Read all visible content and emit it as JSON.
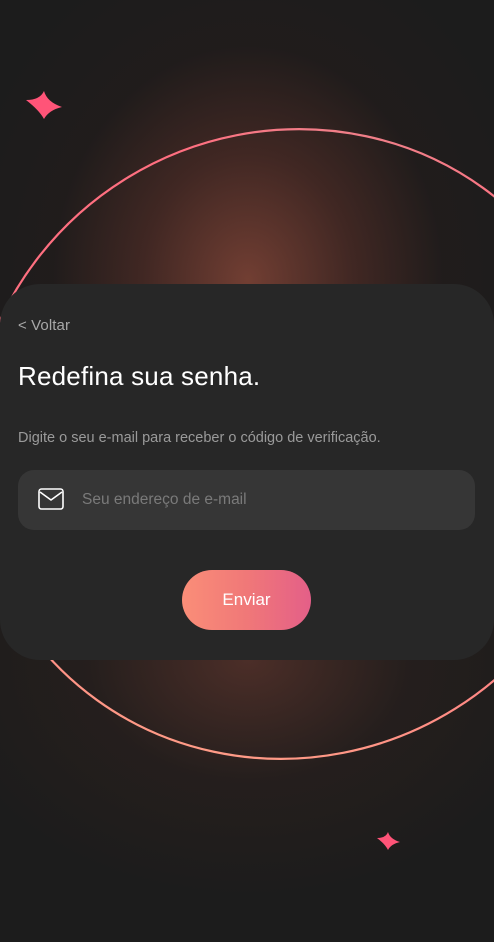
{
  "back_label": "< Voltar",
  "title": "Redefina sua senha.",
  "description": "Digite o seu e-mail para receber o código de verificação.",
  "email": {
    "placeholder": "Seu endereço de e-mail",
    "value": "",
    "icon": "mail-icon"
  },
  "submit_label": "Enviar",
  "colors": {
    "background": "#1c1c1c",
    "card": "#272727",
    "input": "#363636",
    "accent_start": "#fa8e78",
    "accent_end": "#e45f88",
    "sparkle": "#ff5478"
  }
}
